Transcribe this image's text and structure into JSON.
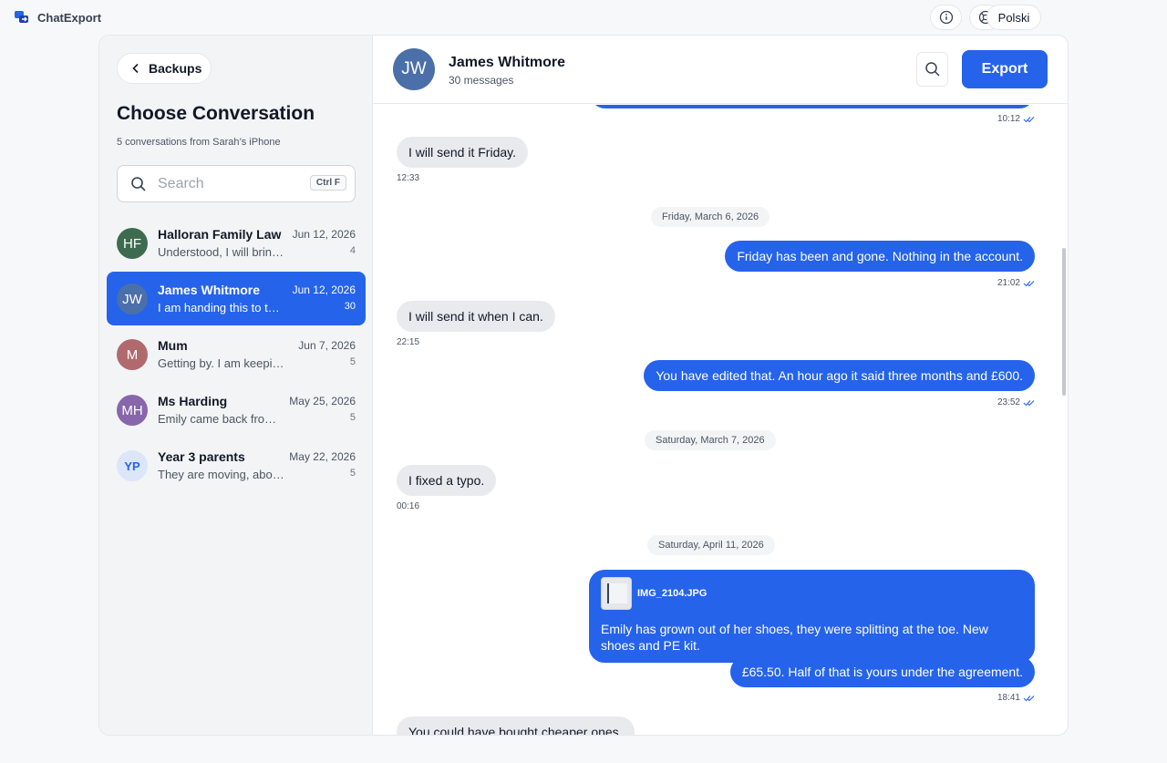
{
  "app": {
    "name": "ChatExport",
    "language": "Polski"
  },
  "left": {
    "back_label": "Backups",
    "title": "Choose Conversation",
    "subtitle": "5 conversations from Sarah’s iPhone",
    "search_placeholder": "Search",
    "search_shortcut": "Ctrl F",
    "conversations": [
      {
        "initials": "HF",
        "name": "Halloran Family Law",
        "preview": "Understood, I will bring the documents",
        "date": "Jun 12, 2026",
        "count": "4",
        "color": "#3d6b4f"
      },
      {
        "initials": "JW",
        "name": "James Whitmore",
        "preview": "I am handing this to the solicitor",
        "date": "Jun 12, 2026",
        "count": "30",
        "color": "#4b6fa8"
      },
      {
        "initials": "M",
        "name": "Mum",
        "preview": "Getting by. I am keeping a record",
        "date": "Jun 7, 2026",
        "count": "5",
        "color": "#b06a6e"
      },
      {
        "initials": "MH",
        "name": "Ms Harding",
        "preview": "Emily came back from school upset",
        "date": "May 25, 2026",
        "count": "5",
        "color": "#8866ac"
      },
      {
        "initials": "YP",
        "name": "Year 3 parents",
        "preview": "They are moving, about the trip",
        "date": "May 22, 2026",
        "count": "5",
        "color": "#dbe6fb"
      }
    ]
  },
  "chat": {
    "initials": "JW",
    "name": "James Whitmore",
    "message_count": "30 messages",
    "export_label": "Export",
    "items": {
      "t0": "10:12",
      "m1": "I will send it Friday.",
      "t1": "12:33",
      "d1": "Friday, March 6, 2026",
      "m2": "Friday has been and gone. Nothing in the account.",
      "t2": "21:02",
      "m3": "I will send it when I can.",
      "t3": "22:15",
      "m4": "You have edited that. An hour ago it said three months and £600.",
      "t4": "23:52",
      "d2": "Saturday, March 7, 2026",
      "m5": "I fixed a typo.",
      "t5": "00:16",
      "d3": "Saturday, April 11, 2026",
      "attachment": "IMG_2104.JPG",
      "m6": "Emily has grown out of her shoes, they were splitting at the toe. New shoes and PE kit.",
      "m7": "£65.50. Half of that is yours under the agreement.",
      "t7": "18:41",
      "m8": "You could have bought cheaper ones."
    }
  },
  "colors": {
    "accent": "#2563eb",
    "incoming_bubble": "#e9eaee",
    "panel_bg": "#f3f4f6"
  }
}
